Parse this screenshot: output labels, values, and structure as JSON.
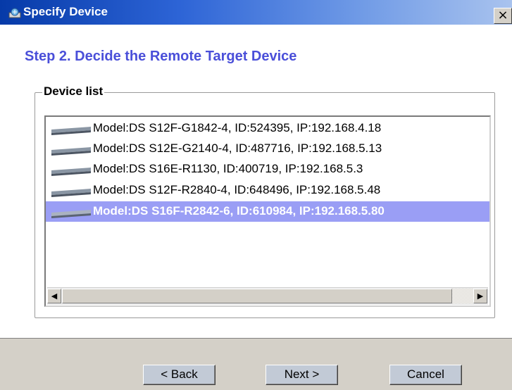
{
  "window": {
    "title": "Specify Device",
    "close_glyph": "×"
  },
  "step_title": "Step 2. Decide the Remote Target Device",
  "device_list": {
    "legend": "Device list",
    "items": [
      {
        "label": "Model:DS S12F-G1842-4, ID:524395, IP:192.168.4.18",
        "icon": "network-device-icon",
        "selected": false
      },
      {
        "label": "Model:DS S12E-G2140-4, ID:487716, IP:192.168.5.13",
        "icon": "network-device-icon",
        "selected": false
      },
      {
        "label": "Model:DS S16E-R1130, ID:400719, IP:192.168.5.3",
        "icon": "network-device-icon",
        "selected": false
      },
      {
        "label": "Model:DS S12F-R2840-4, ID:648496, IP:192.168.5.48",
        "icon": "network-device-icon",
        "selected": false
      },
      {
        "label": "Model:DS S16F-R2842-6, ID:610984, IP:192.168.5.80",
        "icon": "network-device-icon",
        "selected": true
      }
    ],
    "scroll_left_glyph": "◀",
    "scroll_right_glyph": "▶"
  },
  "buttons": {
    "back": "< Back",
    "next": "Next >",
    "cancel": "Cancel"
  },
  "colors": {
    "title_gradient_start": "#063aa8",
    "step_title": "#4a4fd9",
    "selection": "#9a9ef5",
    "footer": "#d4d0c8"
  }
}
